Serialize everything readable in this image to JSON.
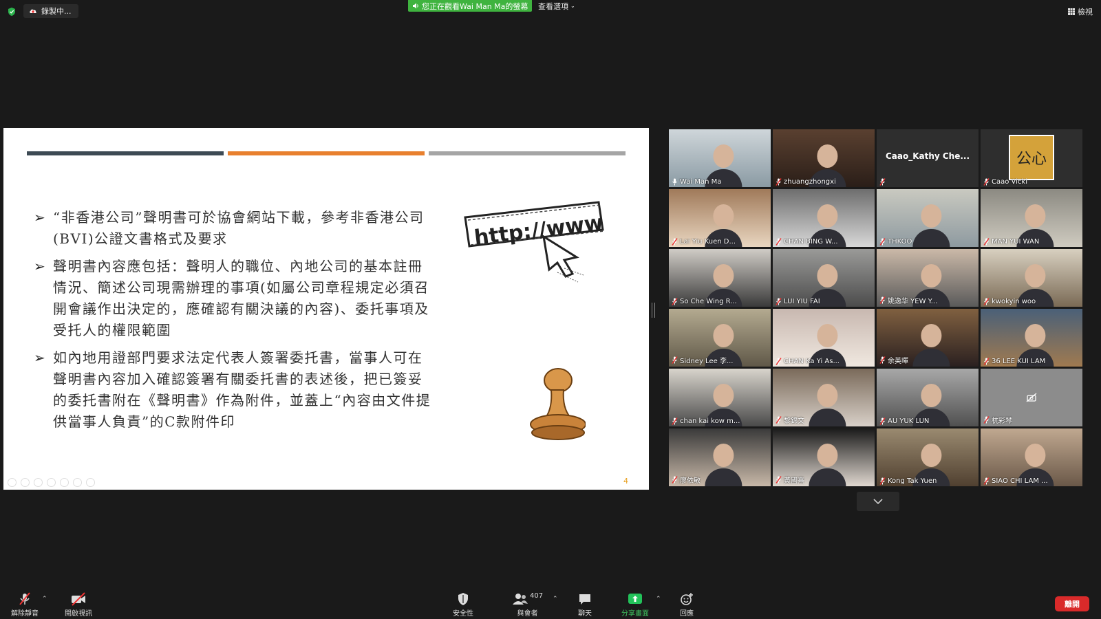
{
  "topbar": {
    "recording_label": "錄製中...",
    "viewing_label": "您正在觀看Wai Man Ma的螢幕",
    "view_options_label": "查看選項",
    "view_label": "檢視"
  },
  "slide": {
    "bullets": [
      "“非香港公司”聲明書可於協會網站下載，參考非香港公司(BVI)公證文書格式及要求",
      "聲明書內容應包括：聲明人的職位、內地公司的基本註冊情況、簡述公司現需辦理的事項(如屬公司章程規定必須召開會議作出決定的，應確認有關決議的內容)、委托事項及受托人的權限範圍",
      "如內地用證部門要求法定代表人簽署委托書，當事人可在聲明書內容加入確認簽署有關委托書的表述後，把已簽妥的委托書附在《聲明書》作為附件，並蓋上“內容由文件提供當事人負責”的C款附件印"
    ],
    "url_graphic_text": "http://www",
    "page_number": "4"
  },
  "participants": [
    {
      "name": "Wai Man Ma",
      "active": true
    },
    {
      "name": "zhuangzhongxi"
    },
    {
      "name": "",
      "display_name": "Caao_Kathy Che..."
    },
    {
      "name": "Caao Vicki",
      "logo_text": "公心"
    },
    {
      "name": "Lai Yiu Kuen D..."
    },
    {
      "name": "CHAN BING W..."
    },
    {
      "name": "THKOO"
    },
    {
      "name": "MAN YUI WAN"
    },
    {
      "name": "So Che Wing R..."
    },
    {
      "name": "LUI YIU FAI"
    },
    {
      "name": "姚逸华 YEW Y..."
    },
    {
      "name": "kwokyin woo"
    },
    {
      "name": "Sidney Lee 李..."
    },
    {
      "name": "CHAN Ka Yi As..."
    },
    {
      "name": "余英暉"
    },
    {
      "name": "36 LEE KUI LAM"
    },
    {
      "name": "chan kai kow m..."
    },
    {
      "name": "黎錦文"
    },
    {
      "name": "AU YUK LUN"
    },
    {
      "name": "杭彩琴",
      "camera_off": true
    },
    {
      "name": "廖依敏"
    },
    {
      "name": "黃國熹"
    },
    {
      "name": "Kong Tak Yuen"
    },
    {
      "name": "SIAO CHI LAM ..."
    }
  ],
  "toolbar": {
    "unmute_label": "解除靜音",
    "video_label": "開啟視訊",
    "security_label": "安全性",
    "participants_label": "與會者",
    "participants_count": "407",
    "chat_label": "聊天",
    "share_label": "分享畫面",
    "reactions_label": "回應",
    "leave_label": "離開"
  },
  "colors": {
    "share_green": "#3fb33f",
    "active_speaker": "#c8e06a",
    "leave_red": "#d92a2a",
    "stripe_dark": "#3d4a54",
    "stripe_orange": "#e8802e",
    "stripe_gray": "#a5a5a5"
  }
}
